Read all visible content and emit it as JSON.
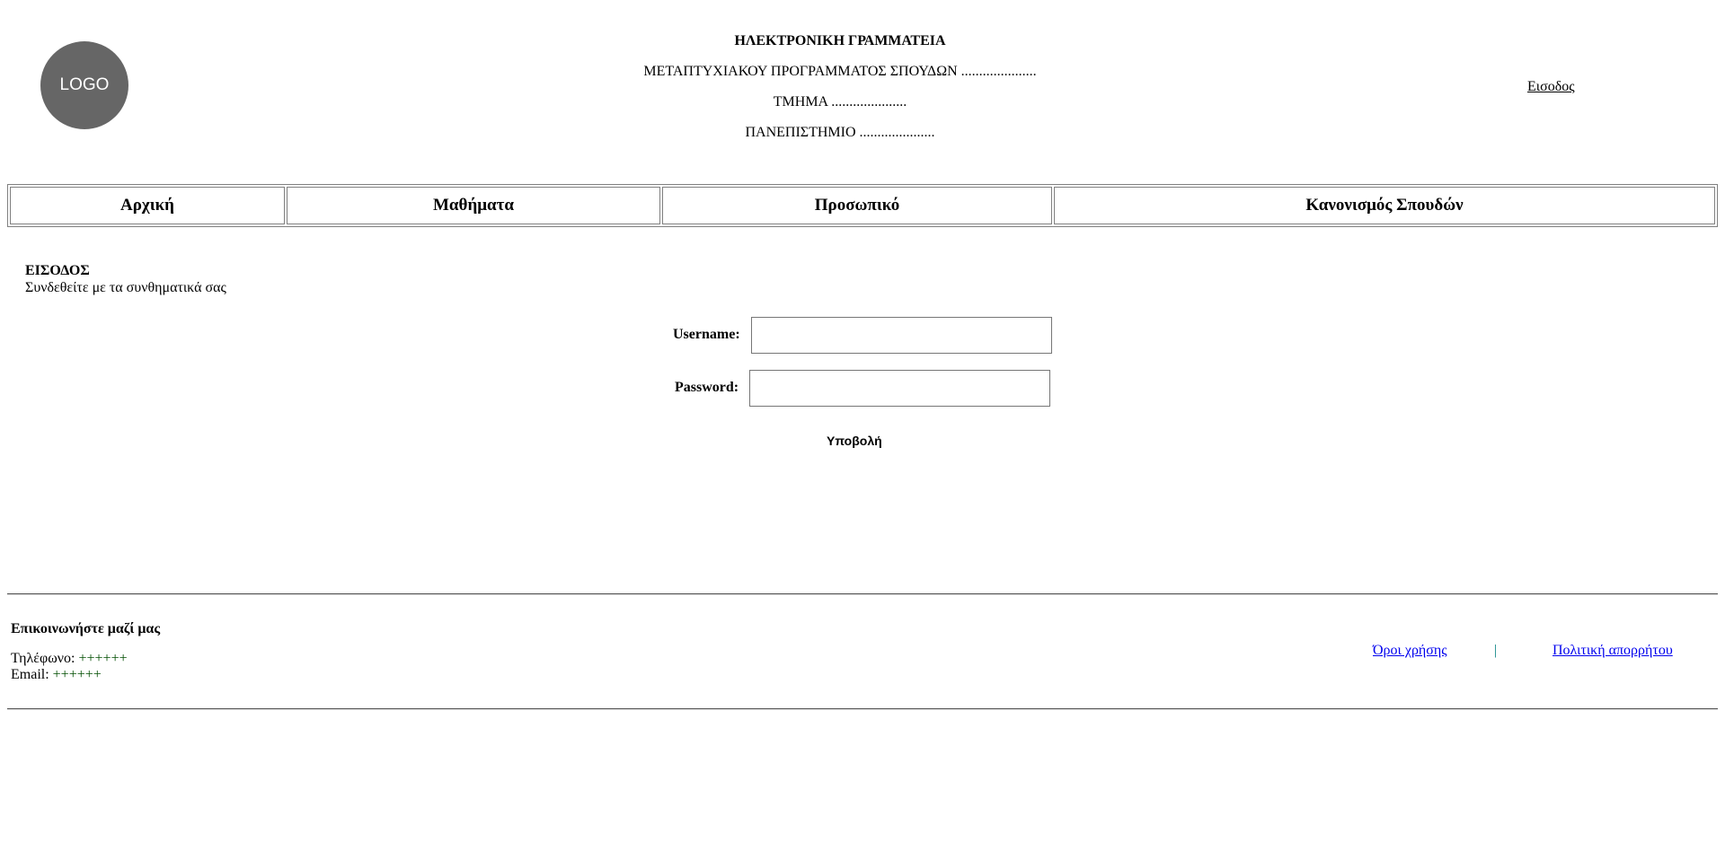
{
  "header": {
    "logo_text": "LOGO",
    "title": "ΗΛΕΚΤΡΟΝΙΚΗ ΓΡΑΜΜΑΤΕΙΑ",
    "program": "ΜΕΤΑΠΤΥΧΙΑΚΟΥ ΠΡΟΓΡΑΜΜΑΤΟΣ ΣΠΟΥΔΩΝ .....................",
    "department": "ΤΜΗΜΑ .....................",
    "university": "ΠΑΝΕΠΙΣΤΗΜΙΟ .....................",
    "login_link": "Εισοδος"
  },
  "nav": {
    "items": [
      {
        "label": "Αρχική"
      },
      {
        "label": "Μαθήματα"
      },
      {
        "label": "Προσωπικό"
      },
      {
        "label": "Κανονισμός Σπουδών"
      }
    ]
  },
  "login": {
    "title": "ΕΙΣΟΔΟΣ",
    "subtitle": "Συνδεθείτε με τα συνθηματικά σας",
    "username_label": "Username:",
    "username_value": "",
    "password_label": "Password:",
    "password_value": "",
    "submit_label": "Υποβολή"
  },
  "footer": {
    "contact_title": "Επικοινωνήστε μαζί μας",
    "phone_label": "Τηλέφωνο:",
    "phone_value": "++++++",
    "email_label": "Email:",
    "email_value": "++++++",
    "terms_link": "Όροι χρήσης",
    "separator": "|",
    "privacy_link": "Πολιτική απορρήτου"
  }
}
